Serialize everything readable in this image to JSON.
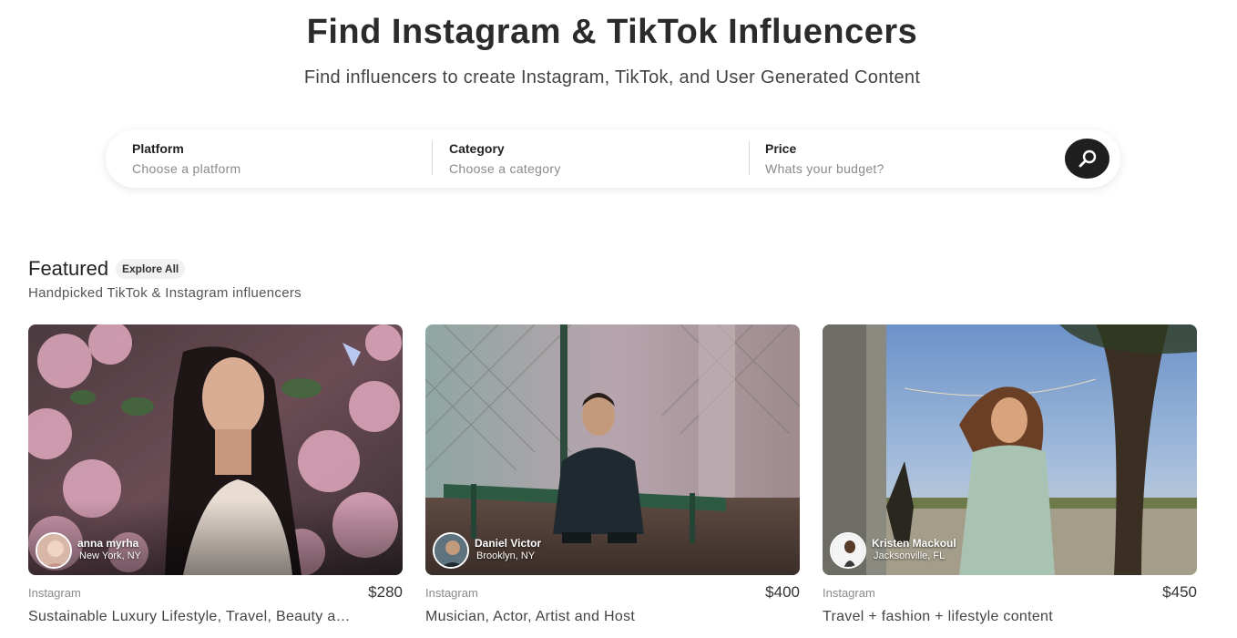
{
  "hero": {
    "title": "Find Instagram & TikTok Influencers",
    "subtitle": "Find influencers to create Instagram, TikTok, and User Generated Content"
  },
  "search": {
    "platform": {
      "label": "Platform",
      "placeholder": "Choose a platform"
    },
    "category": {
      "label": "Category",
      "placeholder": "Choose a category"
    },
    "price": {
      "label": "Price",
      "placeholder": "Whats your budget?"
    },
    "button_icon": "search-icon"
  },
  "featured": {
    "title": "Featured",
    "explore_label": "Explore All",
    "subtitle": "Handpicked TikTok & Instagram influencers",
    "cards": [
      {
        "name": "anna myrha",
        "location": "New York, NY",
        "platform": "Instagram",
        "price": "$280",
        "description": "Sustainable Luxury Lifestyle, Travel, Beauty and ..."
      },
      {
        "name": "Daniel Victor",
        "location": "Brooklyn, NY",
        "platform": "Instagram",
        "price": "$400",
        "description": "Musician, Actor, Artist and Host"
      },
      {
        "name": "Kristen Mackoul",
        "location": "Jacksonville, FL",
        "platform": "Instagram",
        "price": "$450",
        "description": "Travel + fashion + lifestyle content"
      }
    ]
  },
  "colors": {
    "search_button": "#1f1f1f",
    "text_dark": "#2b2b2b",
    "muted": "#8a8a8a"
  }
}
